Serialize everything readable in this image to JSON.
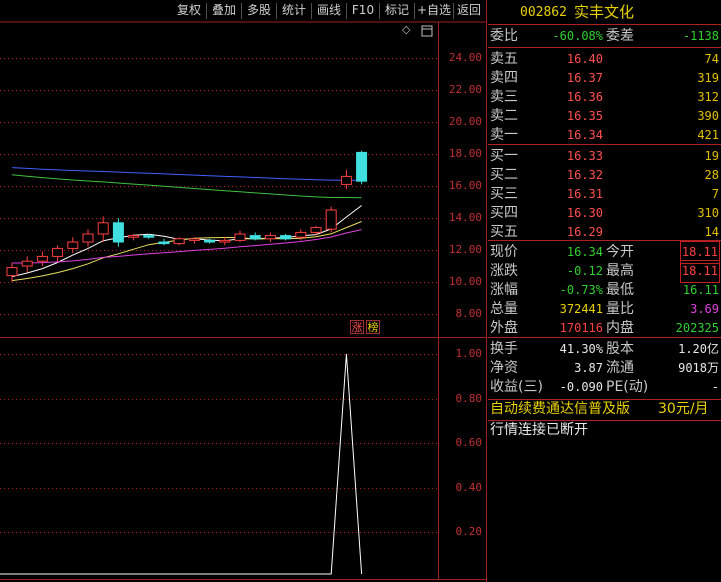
{
  "toolbar": {
    "buttons": [
      "复权",
      "叠加",
      "多股",
      "统计",
      "画线",
      "F10",
      "标记",
      "+自选",
      "返回"
    ]
  },
  "chart": {
    "price_axis": [
      "24.00",
      "22.00",
      "20.00",
      "18.00",
      "16.00",
      "14.00",
      "12.00",
      "10.00",
      "8.00"
    ],
    "sub_axis": [
      "1.00",
      "0.80",
      "0.60",
      "0.40",
      "0.20"
    ],
    "tags": [
      "涨",
      "榜"
    ],
    "diamond_icon": "◇",
    "colors": {
      "up": "#ff4040",
      "down": "#40e0e0",
      "ma5": "#ffffff",
      "ma10": "#e8e060",
      "ma20": "#e040e0",
      "ma60": "#40c040",
      "ma_long": "#4060ff",
      "grid": "#a02020"
    }
  },
  "chart_data": {
    "type": "candlestick",
    "ylim": [
      7,
      25
    ],
    "ohlc": [
      [
        10.4,
        11.2,
        10.0,
        10.9
      ],
      [
        11.0,
        11.6,
        10.6,
        11.3
      ],
      [
        11.3,
        11.9,
        11.0,
        11.6
      ],
      [
        11.6,
        12.3,
        11.3,
        12.1
      ],
      [
        12.1,
        12.8,
        11.8,
        12.5
      ],
      [
        12.5,
        13.3,
        12.2,
        13.0
      ],
      [
        13.0,
        14.1,
        12.5,
        13.7
      ],
      [
        13.7,
        14.0,
        12.2,
        12.5
      ],
      [
        12.8,
        13.0,
        12.6,
        12.9
      ],
      [
        12.9,
        13.0,
        12.7,
        12.8
      ],
      [
        12.5,
        12.7,
        12.3,
        12.4
      ],
      [
        12.4,
        12.8,
        12.3,
        12.7
      ],
      [
        12.6,
        12.8,
        12.4,
        12.7
      ],
      [
        12.6,
        12.7,
        12.4,
        12.5
      ],
      [
        12.5,
        12.8,
        12.3,
        12.6
      ],
      [
        12.6,
        13.2,
        12.5,
        13.0
      ],
      [
        12.9,
        13.1,
        12.6,
        12.7
      ],
      [
        12.7,
        13.1,
        12.5,
        12.9
      ],
      [
        12.9,
        13.0,
        12.6,
        12.7
      ],
      [
        12.8,
        13.3,
        12.6,
        13.1
      ],
      [
        13.1,
        13.5,
        12.9,
        13.4
      ],
      [
        13.3,
        14.7,
        13.1,
        14.5
      ],
      [
        16.1,
        17.0,
        15.8,
        16.6
      ],
      [
        18.1,
        18.2,
        16.1,
        16.3
      ]
    ],
    "sub_series": [
      0,
      0,
      0,
      0,
      0,
      0,
      0,
      0,
      0,
      0,
      0,
      0,
      0,
      0,
      0,
      0,
      0,
      0,
      0,
      0,
      0,
      0,
      1,
      0
    ],
    "sub_ylim": [
      0,
      1.0
    ]
  },
  "quote": {
    "code": "002862",
    "name": "实丰文化",
    "weibi_label": "委比",
    "weibi": "-60.08%",
    "weicha_label": "委差",
    "weicha": "-1138",
    "asks": [
      {
        "label": "卖五",
        "price": "16.40",
        "vol": "74"
      },
      {
        "label": "卖四",
        "price": "16.37",
        "vol": "319"
      },
      {
        "label": "卖三",
        "price": "16.36",
        "vol": "312"
      },
      {
        "label": "卖二",
        "price": "16.35",
        "vol": "390"
      },
      {
        "label": "卖一",
        "price": "16.34",
        "vol": "421"
      }
    ],
    "bids": [
      {
        "label": "买一",
        "price": "16.33",
        "vol": "19"
      },
      {
        "label": "买二",
        "price": "16.32",
        "vol": "28"
      },
      {
        "label": "买三",
        "price": "16.31",
        "vol": "7"
      },
      {
        "label": "买四",
        "price": "16.30",
        "vol": "310"
      },
      {
        "label": "买五",
        "price": "16.29",
        "vol": "14"
      }
    ],
    "stats": [
      {
        "l1": "现价",
        "v1": "16.34",
        "c1": "green",
        "l2": "今开",
        "v2": "18.11",
        "c2": "red",
        "box2": true
      },
      {
        "l1": "涨跌",
        "v1": "-0.12",
        "c1": "green",
        "l2": "最高",
        "v2": "18.11",
        "c2": "red",
        "box2": true
      },
      {
        "l1": "涨幅",
        "v1": "-0.73%",
        "c1": "green",
        "l2": "最低",
        "v2": "16.11",
        "c2": "green",
        "box2": false
      },
      {
        "l1": "总量",
        "v1": "372441",
        "c1": "yellow",
        "l2": "量比",
        "v2": "3.69",
        "c2": "magenta",
        "box2": false
      },
      {
        "l1": "外盘",
        "v1": "170116",
        "c1": "red",
        "l2": "内盘",
        "v2": "202325",
        "c2": "green",
        "box2": false
      }
    ],
    "finance": [
      {
        "l1": "换手",
        "v1": "41.30%",
        "l2": "股本",
        "v2": "1.20亿"
      },
      {
        "l1": "净资",
        "v1": "3.87",
        "l2": "流通",
        "v2": "9018万"
      },
      {
        "l1": "收益(三)",
        "v1": "-0.090",
        "l2": "PE(动)",
        "v2": "-"
      }
    ],
    "ad_text": "自动续费通达信普及版",
    "ad_price": "30元/月",
    "status_text": "行情连接已断开"
  }
}
